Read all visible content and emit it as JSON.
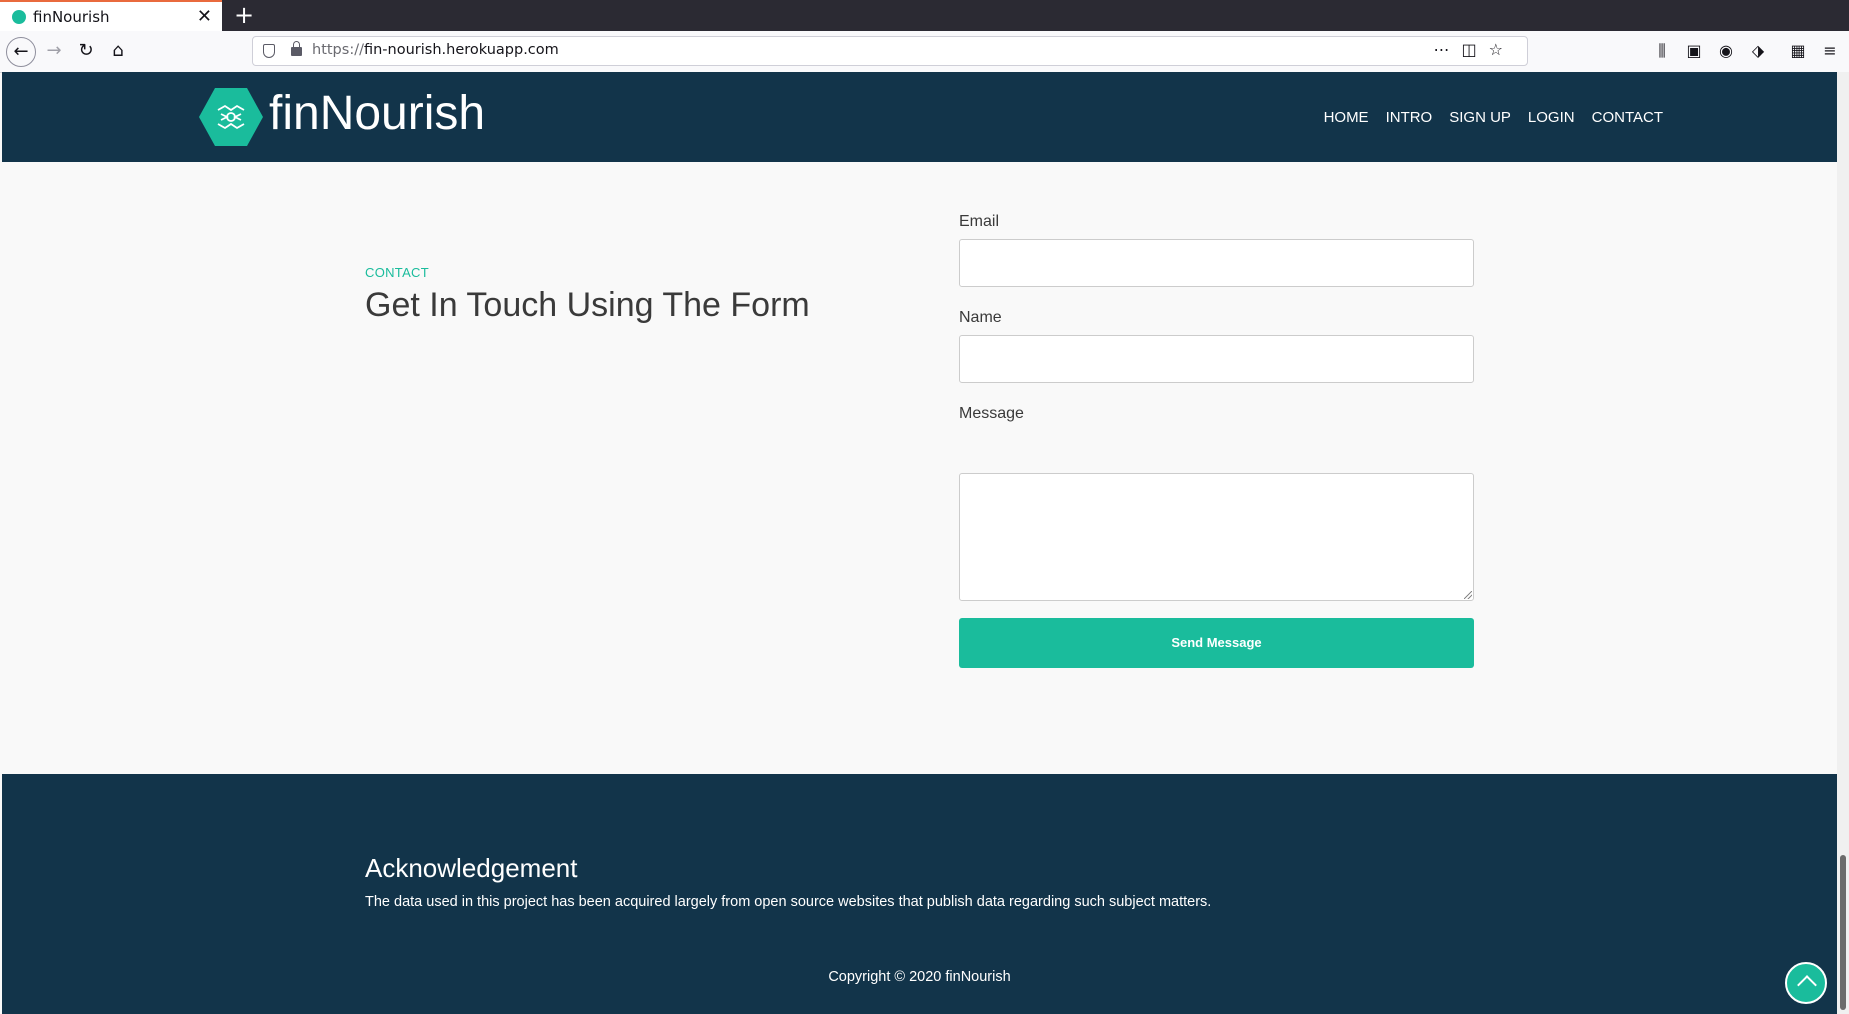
{
  "browser": {
    "tab_title": "finNourish",
    "url_prefix": "https://",
    "url_host": "fin-nourish.herokuapp.com"
  },
  "header": {
    "brand": "finNourish",
    "nav": [
      "HOME",
      "INTRO",
      "SIGN UP",
      "LOGIN",
      "CONTACT"
    ]
  },
  "contact": {
    "eyebrow": "CONTACT",
    "heading": "Get In Touch Using The Form",
    "email_label": "Email",
    "email_value": "",
    "name_label": "Name",
    "name_value": "",
    "message_label": "Message",
    "message_value": "",
    "send_label": "Send Message"
  },
  "footer": {
    "ack_title": "Acknowledgement",
    "ack_text": "The data used in this project has been acquired largely from open source websites that publish data regarding such subject matters.",
    "copyright": "Copyright © 2020 finNourish"
  },
  "colors": {
    "accent": "#1abc9c",
    "navy": "#12344a"
  }
}
